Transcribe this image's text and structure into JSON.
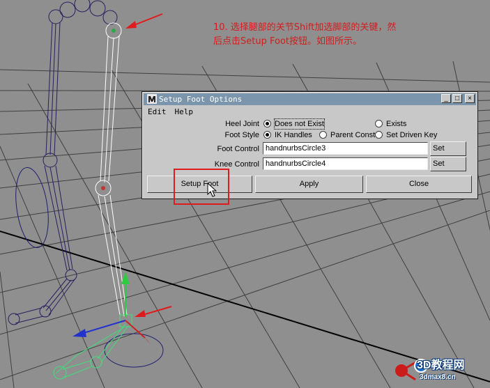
{
  "annotation": {
    "line1": "10. 选择腿部的关节Shift加选脚部的关键，然",
    "line2": "后点击Setup Foot按钮。如图所示。"
  },
  "dialog": {
    "title": "Setup Foot Options",
    "menu": [
      "Edit",
      "Help"
    ],
    "window_buttons": {
      "minimize": "_",
      "maximize": "□",
      "close": "×"
    },
    "heel_joint": {
      "label": "Heel Joint",
      "options": [
        "Does not Exist",
        "Exists"
      ],
      "selected": "Does not Exist"
    },
    "foot_style": {
      "label": "Foot Style",
      "options": [
        "IK Handles",
        "Parent Const",
        "Set Driven Key"
      ],
      "selected": "IK Handles"
    },
    "foot_control": {
      "label": "Foot Control",
      "value": "handnurbsCircle3",
      "button": "Set"
    },
    "knee_control": {
      "label": "Knee Control",
      "value": "handnurbsCircle4",
      "button": "Set"
    },
    "buttons": {
      "setup": "Setup Foot",
      "apply": "Apply",
      "close": "Close"
    }
  },
  "watermark": {
    "brand": "3D教程网",
    "domain": "3dmax8.cn"
  },
  "colors": {
    "viewport_bg": "#8f8f8f",
    "grid": "#3e3e3e",
    "skeleton": "#2a1d5e",
    "selected": "#ffffff",
    "annotation": "#d21d1d",
    "titlebar": "#7b95ad",
    "highlight": "#e11b1b"
  }
}
